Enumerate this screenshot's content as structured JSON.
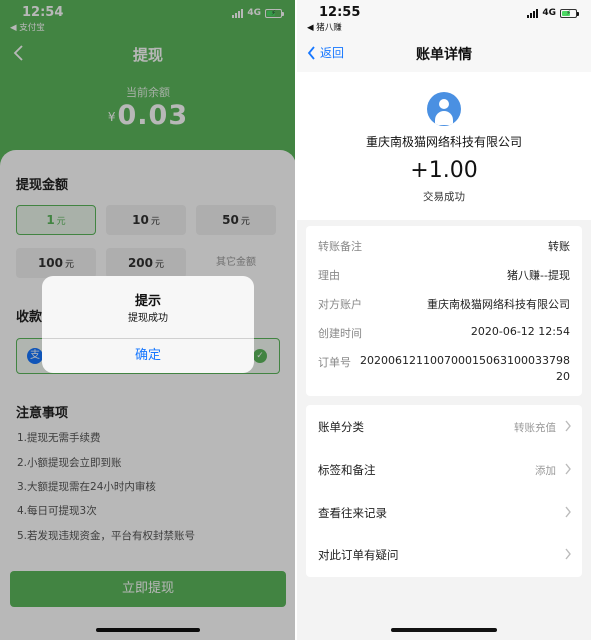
{
  "left": {
    "status": {
      "time": "12:54",
      "app": "◀ 支付宝",
      "network": "4G"
    },
    "nav": {
      "title": "提现"
    },
    "balance": {
      "label": "当前余额",
      "currency": "¥",
      "value": "0.03"
    },
    "amount_section": {
      "title": "提现金额"
    },
    "amounts": [
      {
        "value": "1",
        "unit": "元"
      },
      {
        "value": "10",
        "unit": "元"
      },
      {
        "value": "50",
        "unit": "元"
      },
      {
        "value": "100",
        "unit": "元"
      },
      {
        "value": "200",
        "unit": "元"
      },
      {
        "value": "其它金额",
        "unit": ""
      }
    ],
    "payee_section": {
      "title": "收款"
    },
    "notes": {
      "title": "注意事项",
      "items": [
        "1.提现无需手续费",
        "2.小额提现会立即到账",
        "3.大额提现需在24小时内审核",
        "4.每日可提现3次",
        "5.若发现违规资金，平台有权封禁账号"
      ]
    },
    "withdraw_button": "立即提现",
    "dialog": {
      "title": "提示",
      "message": "提现成功",
      "confirm": "确定"
    }
  },
  "right": {
    "status": {
      "time": "12:55",
      "app": "◀ 猪八赚",
      "network": "4G"
    },
    "nav": {
      "back": "返回",
      "title": "账单详情"
    },
    "header": {
      "company": "重庆南极猫网络科技有限公司",
      "amount": "+1.00",
      "status": "交易成功"
    },
    "details": [
      {
        "label": "转账备注",
        "value": "转账"
      },
      {
        "label": "理由",
        "value": "猪八赚--提现"
      },
      {
        "label": "对方账户",
        "value": "重庆南极猫网络科技有限公司"
      },
      {
        "label": "创建时间",
        "value": "2020-06-12 12:54"
      },
      {
        "label": "订单号",
        "value": "2020061211007000150631000337​9820"
      }
    ],
    "menu": [
      {
        "label": "账单分类",
        "value": "转账充值"
      },
      {
        "label": "标签和备注",
        "value": "添加"
      },
      {
        "label": "查看往来记录",
        "value": ""
      },
      {
        "label": "对此订单有疑问",
        "value": ""
      }
    ]
  },
  "colors": {
    "green": "#5cb85c",
    "blue": "#1677ff"
  }
}
